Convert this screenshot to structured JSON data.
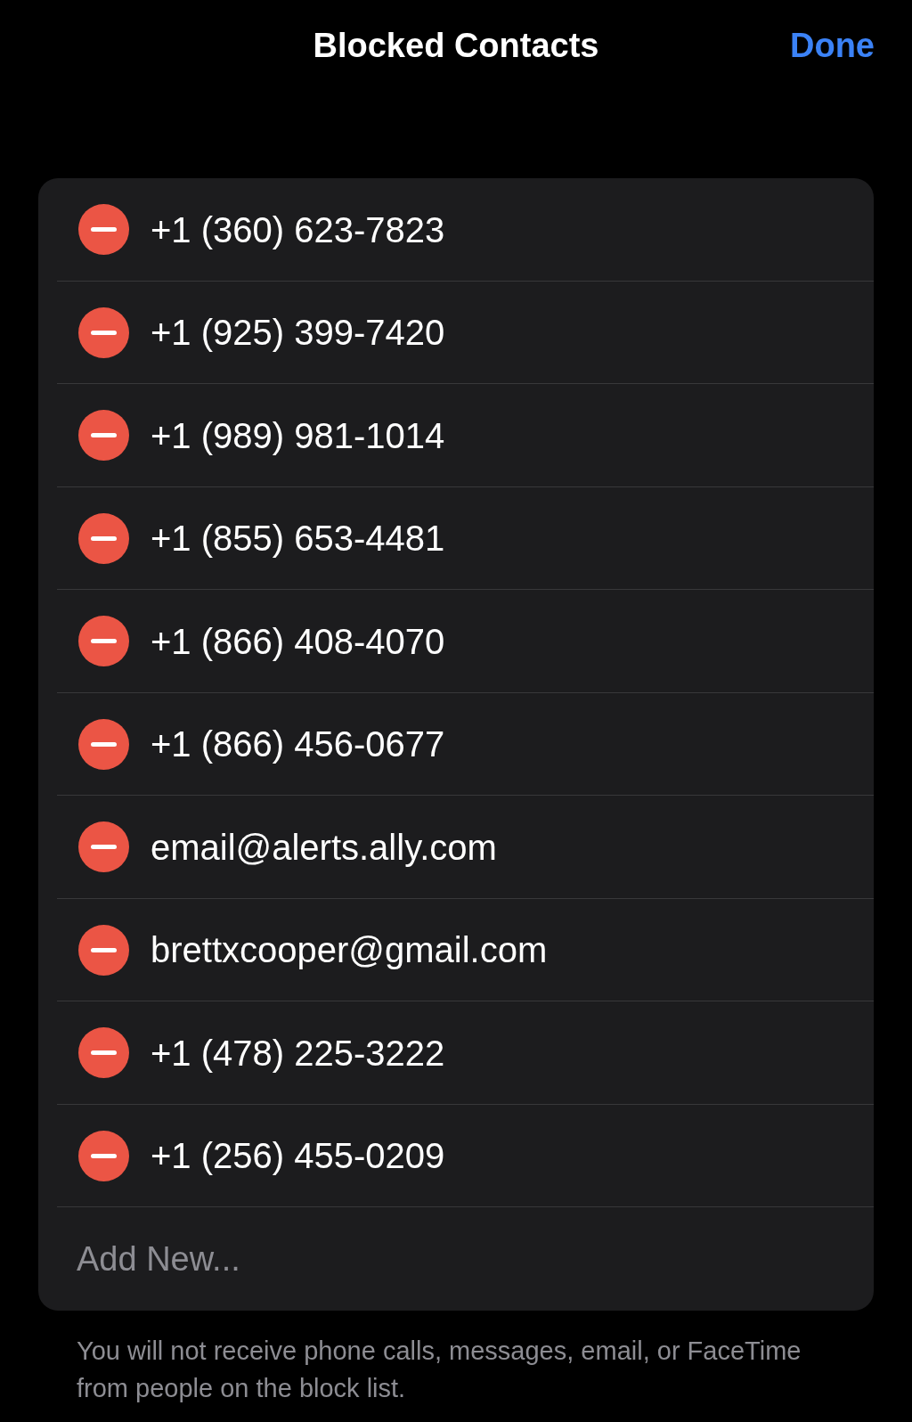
{
  "header": {
    "title": "Blocked Contacts",
    "done_button": "Done"
  },
  "blocked": [
    {
      "contact": "+1 (360) 623-7823"
    },
    {
      "contact": "+1 (925) 399-7420"
    },
    {
      "contact": "+1 (989) 981-1014"
    },
    {
      "contact": "+1 (855) 653-4481"
    },
    {
      "contact": "+1 (866) 408-4070"
    },
    {
      "contact": "+1 (866) 456-0677"
    },
    {
      "contact": "email@alerts.ally.com"
    },
    {
      "contact": "brettxcooper@gmail.com"
    },
    {
      "contact": "+1 (478) 225-3222"
    },
    {
      "contact": "+1 (256) 455-0209"
    }
  ],
  "add_new": "Add New...",
  "footer": "You will not receive phone calls, messages, email, or FaceTime from people on the block list."
}
